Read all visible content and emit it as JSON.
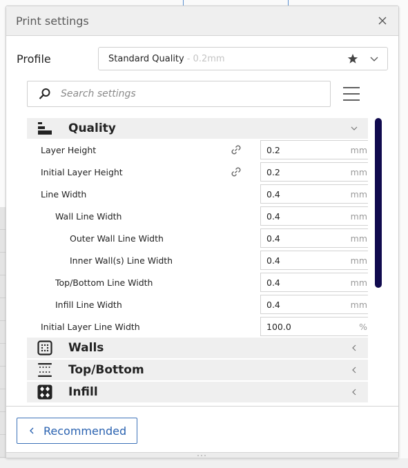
{
  "window": {
    "title": "Print settings",
    "close_icon": "close-icon"
  },
  "profile": {
    "label": "Profile",
    "selected_name": "Standard Quality",
    "selected_suffix": "- 0.2mm",
    "favorite_icon": "star-icon",
    "dropdown_icon": "chevron-down-icon"
  },
  "search": {
    "placeholder": "Search settings",
    "value": "",
    "icon": "search-icon",
    "menu_icon": "hamburger-menu-icon"
  },
  "categories": [
    {
      "label": "Quality",
      "icon": "quality-icon",
      "expanded": true,
      "settings": [
        {
          "label": "Layer Height",
          "value": "0.2",
          "unit": "mm",
          "indent": 0,
          "linked": true
        },
        {
          "label": "Initial Layer Height",
          "value": "0.2",
          "unit": "mm",
          "indent": 0,
          "linked": true
        },
        {
          "label": "Line Width",
          "value": "0.4",
          "unit": "mm",
          "indent": 0,
          "linked": false
        },
        {
          "label": "Wall Line Width",
          "value": "0.4",
          "unit": "mm",
          "indent": 1,
          "linked": false
        },
        {
          "label": "Outer Wall Line Width",
          "value": "0.4",
          "unit": "mm",
          "indent": 2,
          "linked": false
        },
        {
          "label": "Inner Wall(s) Line Width",
          "value": "0.4",
          "unit": "mm",
          "indent": 2,
          "linked": false
        },
        {
          "label": "Top/Bottom Line Width",
          "value": "0.4",
          "unit": "mm",
          "indent": 1,
          "linked": false
        },
        {
          "label": "Infill Line Width",
          "value": "0.4",
          "unit": "mm",
          "indent": 1,
          "linked": false
        },
        {
          "label": "Initial Layer Line Width",
          "value": "100.0",
          "unit": "%",
          "indent": 0,
          "linked": false
        }
      ]
    },
    {
      "label": "Walls",
      "icon": "walls-icon",
      "expanded": false
    },
    {
      "label": "Top/Bottom",
      "icon": "top-bottom-icon",
      "expanded": false
    },
    {
      "label": "Infill",
      "icon": "infill-icon",
      "expanded": false
    }
  ],
  "footer": {
    "recommended_label": "Recommended",
    "recommended_icon": "chevron-left-icon"
  },
  "colors": {
    "accent": "#2a62b0",
    "scrollbar": "#100a4e",
    "header_bg": "#efefef"
  }
}
